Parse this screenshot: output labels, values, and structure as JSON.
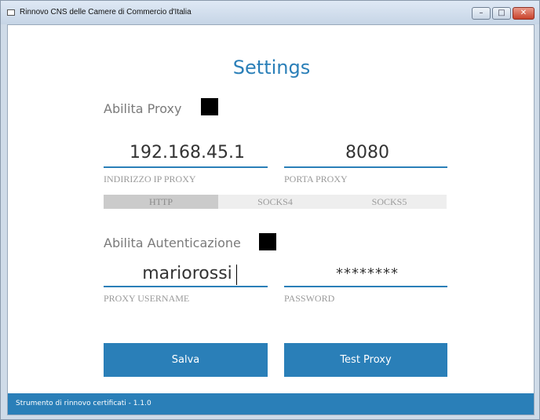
{
  "window": {
    "title": "Rinnovo CNS delle Camere di Commercio d'Italia",
    "controls": {
      "minimize": "–",
      "maximize": "□",
      "close": "✕"
    }
  },
  "page": {
    "title": "Settings"
  },
  "proxy": {
    "enable_label": "Abilita Proxy",
    "enabled": true,
    "ip_value": "192.168.45.1",
    "ip_caption": "INDIRIZZO IP PROXY",
    "port_value": "8080",
    "port_caption": "PORTA PROXY",
    "types": [
      "HTTP",
      "SOCKS4",
      "SOCKS5"
    ],
    "selected_type": "HTTP"
  },
  "auth": {
    "enable_label": "Abilita Autenticazione",
    "enabled": true,
    "username_value": "mariorossi",
    "username_caption": "PROXY USERNAME",
    "password_value": "********",
    "password_caption": "PASSWORD"
  },
  "actions": {
    "save": "Salva",
    "test": "Test Proxy"
  },
  "footer": {
    "text": "Strumento di rinnovo certificati - 1.1.0"
  },
  "colors": {
    "accent": "#2a7fb8",
    "segment_selected": "#cbcbcb",
    "segment_unselected": "#eeeeee"
  }
}
